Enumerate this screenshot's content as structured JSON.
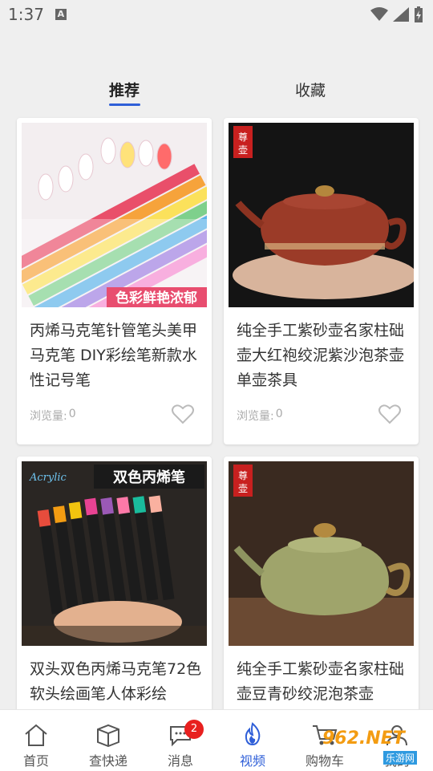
{
  "status_bar": {
    "time": "1:37",
    "notification_icon": "A"
  },
  "tabs": [
    {
      "label": "推荐",
      "active": true
    },
    {
      "label": "收藏",
      "active": false
    }
  ],
  "products": [
    {
      "title": "丙烯马克笔针管笔头美甲马克笔 DIY彩绘笔新款水性记号笔",
      "views_label": "浏览量:",
      "views": "0",
      "image_icon": "nail-art-markers-image",
      "image_caption": "色彩鲜艳浓郁"
    },
    {
      "title": "纯全手工紫砂壶名家柱础壶大红袍绞泥紫沙泡茶壶单壶茶具",
      "views_label": "浏览量:",
      "views": "0",
      "image_icon": "red-teapot-image",
      "image_caption": ""
    },
    {
      "title": "双头双色丙烯马克笔72色软头绘画笔人体彩绘",
      "views_label": "",
      "views": "",
      "image_icon": "acrylic-markers-image",
      "image_caption": "双色丙烯笔"
    },
    {
      "title": "纯全手工紫砂壶名家柱础壶豆青砂绞泥泡茶壶",
      "views_label": "",
      "views": "",
      "image_icon": "green-teapot-image",
      "image_caption": ""
    }
  ],
  "bottom_nav": [
    {
      "label": "首页",
      "icon": "home-icon",
      "active": false
    },
    {
      "label": "查快递",
      "icon": "package-icon",
      "active": false
    },
    {
      "label": "消息",
      "icon": "message-icon",
      "active": false,
      "badge": "2"
    },
    {
      "label": "视频",
      "icon": "flame-icon",
      "active": true
    },
    {
      "label": "购物车",
      "icon": "cart-icon",
      "active": false
    },
    {
      "label": "我的",
      "icon": "user-icon",
      "active": false
    }
  ],
  "watermark": {
    "text": "962.NET",
    "sub": "乐游网"
  },
  "colors": {
    "accent": "#2f5fd8",
    "badge": "#e8201f",
    "background": "#efefef"
  }
}
